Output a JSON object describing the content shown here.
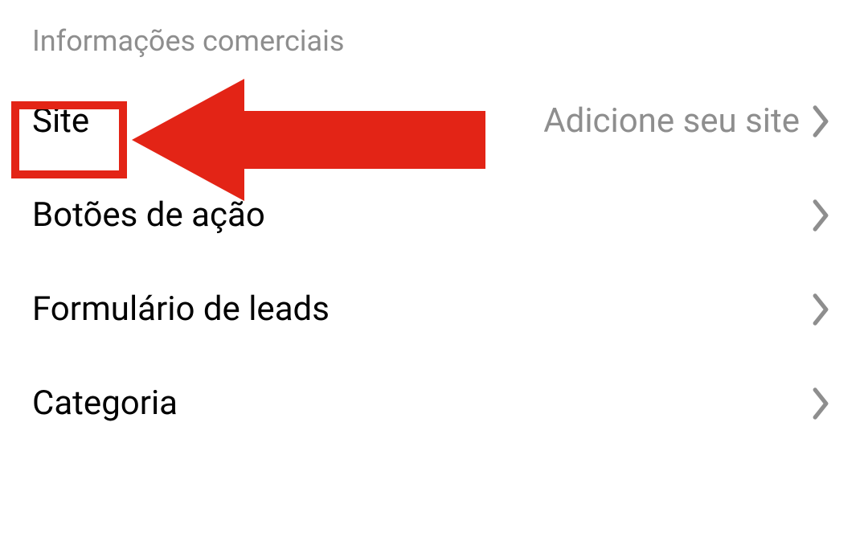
{
  "section": {
    "header": "Informações comerciais"
  },
  "items": [
    {
      "label": "Site",
      "value": "Adicione seu site"
    },
    {
      "label": "Botões de ação",
      "value": ""
    },
    {
      "label": "Formulário de leads",
      "value": ""
    },
    {
      "label": "Categoria",
      "value": ""
    }
  ],
  "annotation": {
    "highlight_color": "#e32416",
    "arrow_color": "#e32416"
  }
}
